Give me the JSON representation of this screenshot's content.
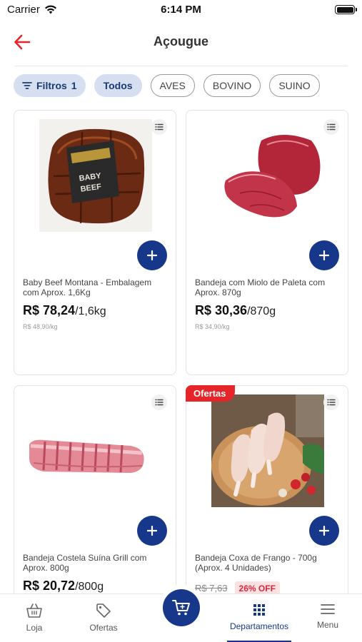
{
  "status_bar": {
    "carrier": "Carrier",
    "time": "6:14 PM"
  },
  "header": {
    "title": "Açougue"
  },
  "filters": {
    "filtros_label": "Filtros",
    "filtros_count": "1",
    "chips": [
      "Todos",
      "AVES",
      "BOVINO",
      "SUINO"
    ]
  },
  "products": [
    {
      "name": "Baby Beef Montana - Embalagem com Aprox. 1,6Kg",
      "price": "R$ 78,24",
      "unit": "/1,6kg",
      "per_kg": "R$ 48,90/kg",
      "image_label": "BABY BEEF"
    },
    {
      "name": "Bandeja com Miolo de Paleta com Aprox. 870g",
      "price": "R$ 30,36",
      "unit": "/870g",
      "per_kg": "R$ 34,90/kg"
    },
    {
      "name": "Bandeja Costela Suína Grill com Aprox. 800g",
      "price": "R$ 20,72",
      "unit": "/800g"
    },
    {
      "name": "Bandeja Coxa de Frango - 700g (Aprox. 4 Unidades)",
      "old_price": "R$ 7,63",
      "discount": "26% OFF",
      "tag": "Ofertas"
    }
  ],
  "bottom_nav": {
    "items": [
      "Loja",
      "Ofertas",
      "Departamentos",
      "Menu"
    ],
    "active": "Departamentos"
  },
  "colors": {
    "brand": "#16378a",
    "back_arrow": "#e5252a",
    "offer": "#e5252a",
    "chip_filled": "#d5dff0"
  },
  "icons": [
    "wifi-icon",
    "battery-icon",
    "back-arrow-icon",
    "filter-icon",
    "list-icon",
    "plus-icon",
    "cart-icon",
    "basket-icon",
    "tag-icon",
    "grid-icon",
    "hamburger-icon"
  ]
}
